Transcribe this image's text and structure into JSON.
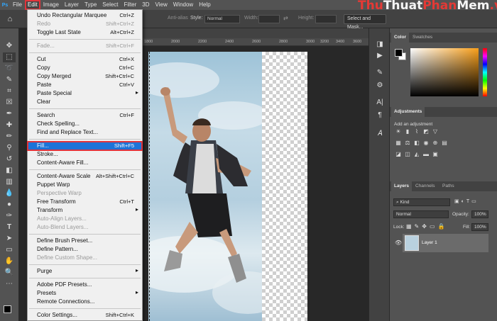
{
  "menubar": {
    "logo": "Ps",
    "items": [
      "File",
      "Edit",
      "Image",
      "Layer",
      "Type",
      "Select",
      "Filter",
      "3D",
      "View",
      "Window",
      "Help"
    ]
  },
  "watermark": {
    "part1": "Thu",
    "part2": "Thuat",
    "part3": "Phan",
    "part4": "Mem",
    "part5": ".vn"
  },
  "options": {
    "antialias": "Anti-alias",
    "style_label": "Style:",
    "style_value": "Normal",
    "width_label": "Width:",
    "height_label": "Height:",
    "select_mask": "Select and Mask..."
  },
  "ruler": [
    "1800",
    "2000",
    "2200",
    "2400",
    "2600",
    "2800",
    "3000",
    "3200",
    "3400",
    "3600"
  ],
  "edit_menu": {
    "items": [
      {
        "label": "Undo Rectangular Marquee",
        "shortcut": "Ctrl+Z",
        "disabled": false
      },
      {
        "label": "Redo",
        "shortcut": "Shift+Ctrl+Z",
        "disabled": true
      },
      {
        "label": "Toggle Last State",
        "shortcut": "Alt+Ctrl+Z",
        "disabled": false
      },
      {
        "label": "Fade...",
        "shortcut": "Shift+Ctrl+F",
        "disabled": true
      },
      {
        "label": "Cut",
        "shortcut": "Ctrl+X",
        "disabled": false
      },
      {
        "label": "Copy",
        "shortcut": "Ctrl+C",
        "disabled": false
      },
      {
        "label": "Copy Merged",
        "shortcut": "Shift+Ctrl+C",
        "disabled": false
      },
      {
        "label": "Paste",
        "shortcut": "Ctrl+V",
        "disabled": false
      },
      {
        "label": "Paste Special",
        "shortcut": "",
        "disabled": false,
        "submenu": true
      },
      {
        "label": "Clear",
        "shortcut": "",
        "disabled": false
      },
      {
        "label": "Search",
        "shortcut": "Ctrl+F",
        "disabled": false
      },
      {
        "label": "Check Spelling...",
        "shortcut": "",
        "disabled": false
      },
      {
        "label": "Find and Replace Text...",
        "shortcut": "",
        "disabled": false
      },
      {
        "label": "Fill...",
        "shortcut": "Shift+F5",
        "disabled": false,
        "highlighted": true
      },
      {
        "label": "Stroke...",
        "shortcut": "",
        "disabled": false
      },
      {
        "label": "Content-Aware Fill...",
        "shortcut": "",
        "disabled": false
      },
      {
        "label": "Content-Aware Scale",
        "shortcut": "Alt+Shift+Ctrl+C",
        "disabled": false
      },
      {
        "label": "Puppet Warp",
        "shortcut": "",
        "disabled": false
      },
      {
        "label": "Perspective Warp",
        "shortcut": "",
        "disabled": true
      },
      {
        "label": "Free Transform",
        "shortcut": "Ctrl+T",
        "disabled": false
      },
      {
        "label": "Transform",
        "shortcut": "",
        "disabled": false,
        "submenu": true
      },
      {
        "label": "Auto-Align Layers...",
        "shortcut": "",
        "disabled": true
      },
      {
        "label": "Auto-Blend Layers...",
        "shortcut": "",
        "disabled": true
      },
      {
        "label": "Define Brush Preset...",
        "shortcut": "",
        "disabled": false
      },
      {
        "label": "Define Pattern...",
        "shortcut": "",
        "disabled": false
      },
      {
        "label": "Define Custom Shape...",
        "shortcut": "",
        "disabled": true
      },
      {
        "label": "Purge",
        "shortcut": "",
        "disabled": false,
        "submenu": true
      },
      {
        "label": "Adobe PDF Presets...",
        "shortcut": "",
        "disabled": false
      },
      {
        "label": "Presets",
        "shortcut": "",
        "disabled": false,
        "submenu": true
      },
      {
        "label": "Remote Connections...",
        "shortcut": "",
        "disabled": false
      },
      {
        "label": "Color Settings...",
        "shortcut": "Shift+Ctrl+K",
        "disabled": false
      }
    ]
  },
  "color_panel": {
    "tab_color": "Color",
    "tab_swatches": "Swatches"
  },
  "adjustments": {
    "title": "Adjustments",
    "hint": "Add an adjustment"
  },
  "layers_panel": {
    "tabs": [
      "Layers",
      "Channels",
      "Paths"
    ],
    "kind": "Kind",
    "blend": "Normal",
    "opacity_label": "Opacity:",
    "opacity": "100%",
    "lock_label": "Lock:",
    "fill_label": "Fill:",
    "fill": "100%",
    "layer_name": "Layer 1"
  },
  "colors": {
    "highlight": "#1c73d8",
    "annotation": "#e0343b",
    "brand_red": "#e53935"
  }
}
